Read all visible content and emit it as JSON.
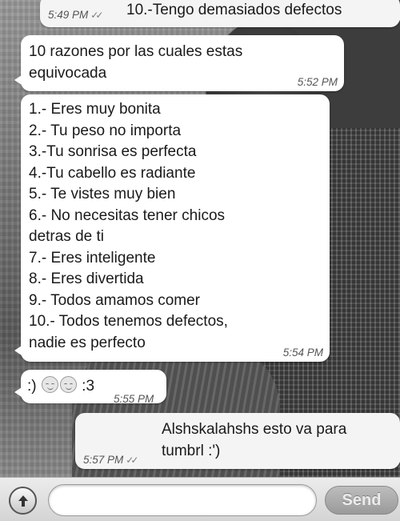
{
  "messages": [
    {
      "id": "b1",
      "direction": "outgoing",
      "text": "10.-Tengo demasiados defectos",
      "time": "5:49 PM",
      "status": "read"
    },
    {
      "id": "b2",
      "direction": "incoming",
      "text": "10 razones por las cuales estas\nequivocada",
      "time": "5:52 PM"
    },
    {
      "id": "b3",
      "direction": "incoming",
      "text": "1.- Eres muy bonita\n2.- Tu peso no importa\n3.-Tu sonrisa es perfecta\n4.-Tu cabello es radiante\n5.- Te vistes muy bien\n6.- No necesitas tener chicos\ndetras de ti\n7.- Eres inteligente\n8.- Eres divertida\n9.- Todos amamos comer\n10.- Todos tenemos defectos,\nnadie es perfecto",
      "time": "5:54 PM"
    },
    {
      "id": "b4",
      "direction": "incoming",
      "text_before": ":)",
      "text_after": ":3",
      "emoji": [
        "smiling-face-icon",
        "smiling-face-icon"
      ],
      "time": "5:55 PM"
    },
    {
      "id": "b5",
      "direction": "outgoing",
      "text": "Alshskalahshs esto va para\ntumbrl :')",
      "time": "5:57 PM",
      "status": "read"
    }
  ],
  "composer": {
    "input_value": "",
    "input_placeholder": "",
    "send_label": "Send",
    "upload_icon": "arrow-up-icon"
  },
  "colors": {
    "bubble_incoming": "#ffffff",
    "bubble_outgoing": "#f4f4f4",
    "text": "#1a1a1a",
    "timestamp": "#555555",
    "send_button": "#a8a8a8"
  }
}
